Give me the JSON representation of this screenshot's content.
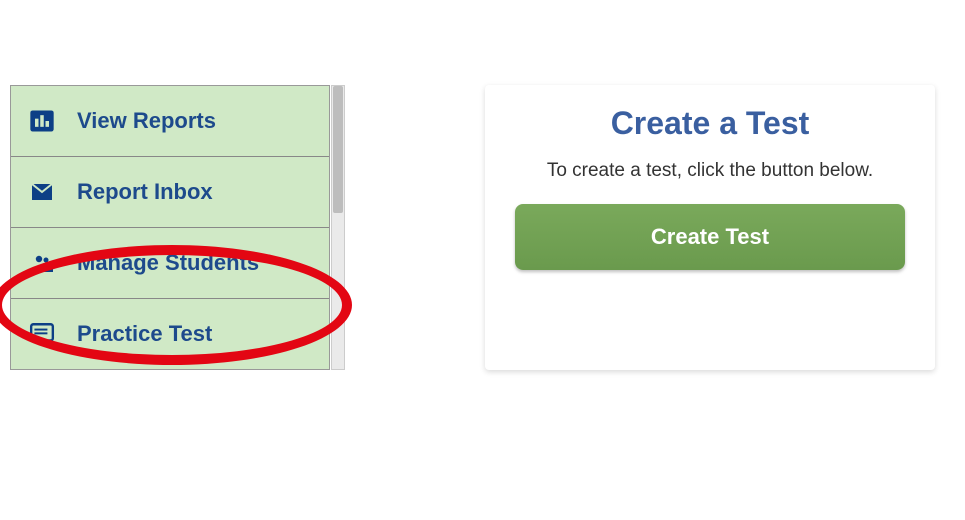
{
  "sidebar": {
    "items": [
      {
        "label": "View Reports",
        "icon": "bar-chart-icon"
      },
      {
        "label": "Report Inbox",
        "icon": "envelope-icon"
      },
      {
        "label": "Manage Students",
        "icon": "people-icon"
      },
      {
        "label": "Practice Test",
        "icon": "monitor-list-icon"
      }
    ]
  },
  "card": {
    "title": "Create a Test",
    "subtitle": "To create a test, click the button below.",
    "button_label": "Create Test"
  },
  "annotation": {
    "highlighted_item_index": 2
  },
  "colors": {
    "sidebar_bg": "#d0e9c6",
    "icon_fill": "#0d3f86",
    "label_color": "#1d4a8c",
    "card_title": "#3a5fa0",
    "button_bg": "#6a9a4d",
    "highlight": "#e30613"
  }
}
